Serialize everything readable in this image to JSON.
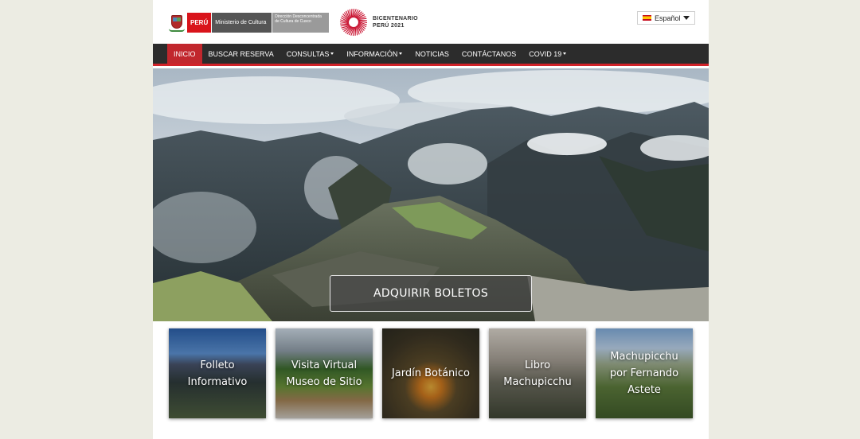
{
  "header": {
    "peru_label": "PERÚ",
    "ministry_label": "Ministerio de Cultura",
    "direction_label": "Dirección Desconcentrada de Cultura de Cusco",
    "bicentenario_line1": "BICENTENARIO",
    "bicentenario_line2": "PERÚ 2021",
    "language": {
      "selected": "Español",
      "flag": "spain-flag"
    }
  },
  "nav": {
    "items": [
      {
        "label": "INICIO",
        "active": true,
        "dropdown": false
      },
      {
        "label": "BUSCAR RESERVA",
        "active": false,
        "dropdown": false
      },
      {
        "label": "CONSULTAS",
        "active": false,
        "dropdown": true
      },
      {
        "label": "INFORMACIÓN",
        "active": false,
        "dropdown": true
      },
      {
        "label": "NOTICIAS",
        "active": false,
        "dropdown": false
      },
      {
        "label": "CONTÁCTANOS",
        "active": false,
        "dropdown": false
      },
      {
        "label": "COVID 19",
        "active": false,
        "dropdown": true
      }
    ]
  },
  "hero": {
    "button_label": "ADQUIRIR BOLETOS"
  },
  "cards": [
    {
      "title": "Folleto Informativo"
    },
    {
      "title": "Visita Virtual Museo de Sitio"
    },
    {
      "title": "Jardín Botánico"
    },
    {
      "title": "Libro Machupicchu"
    },
    {
      "title": "Machupicchu por Fernando Astete"
    }
  ],
  "colors": {
    "nav_bg": "#2c2c2c",
    "accent_red": "#c1272d",
    "page_bg": "#ecece3"
  }
}
